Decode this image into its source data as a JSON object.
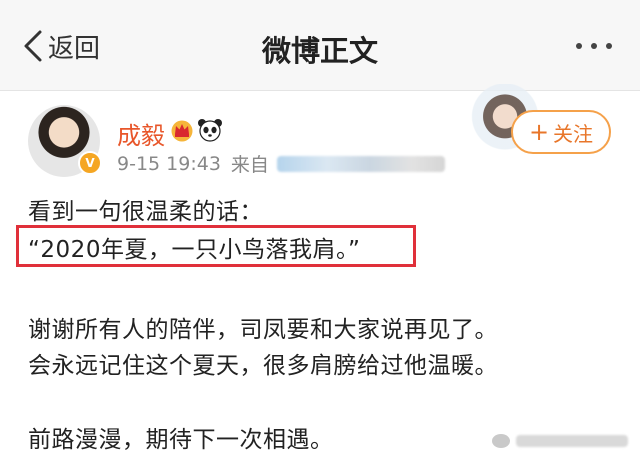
{
  "nav": {
    "back_label": "返回",
    "title": "微博正文",
    "more_icon": "more-dots-icon"
  },
  "post": {
    "author": "成毅",
    "badges": [
      "crown-vip-icon",
      "panda-emoji-icon",
      "verified-v-icon"
    ],
    "timestamp": "9-15 19:43",
    "source_prefix": "来自",
    "follow_label": "关注",
    "lines": [
      "看到一句很温柔的话：",
      "“2020年夏，一只小鸟落我肩。”",
      "谢谢所有人的陪伴，司凤要和大家说再见了。",
      "会永远记住这个夏天，很多肩膀给过他温暖。",
      "前路漫漫，期待下一次相遇。"
    ]
  },
  "colors": {
    "username": "#e8562a",
    "follow_border": "#f5a14a",
    "highlight_box": "#e0303a",
    "topbar_bg": "#f7f7f7"
  }
}
